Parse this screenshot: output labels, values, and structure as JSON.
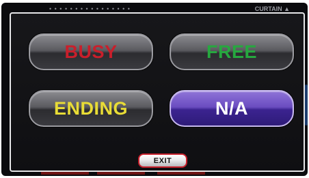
{
  "background": {
    "topbar_text": "• • • • • • • • • • • • • • • •",
    "topbar_right": "CURTAIN ▲"
  },
  "dialog": {
    "buttons": [
      {
        "label": "BUSY",
        "color": "#c91f2b"
      },
      {
        "label": "FREE",
        "color": "#26a83f"
      },
      {
        "label": "ENDING",
        "color": "#e8dc36"
      },
      {
        "label": "N/A",
        "color": "#ffffff",
        "selected": true
      }
    ],
    "exit_label": "EXIT"
  },
  "colors": {
    "frame_border": "#e7e7e9",
    "selected_fill": "#6a4cc0",
    "exit_border": "#c8202c"
  }
}
